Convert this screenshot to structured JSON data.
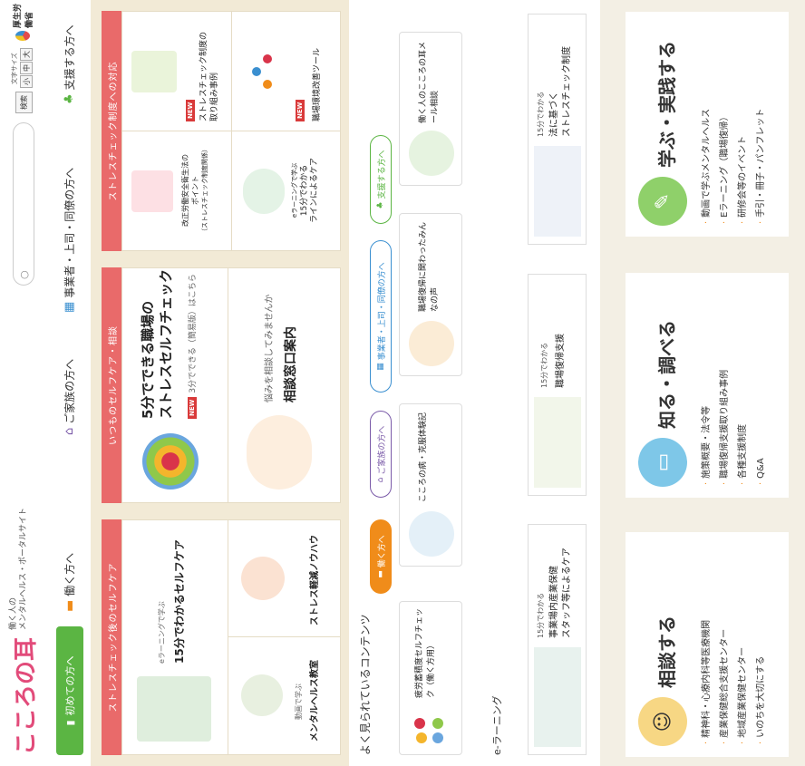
{
  "header": {
    "logo": "こころの耳",
    "subtitle_line1": "働く人の",
    "subtitle_line2": "メンタルヘルス・ポータルサイト",
    "first_time_button": "初めての方へ",
    "nav": [
      "働く方へ",
      "ご家族の方へ",
      "事業者・上司・同僚の方へ",
      "支援する方へ"
    ],
    "search_button": "検索",
    "font_size_label": "文字サイズ",
    "font_sizes": [
      "小",
      "中",
      "大"
    ],
    "ministry": "厚生労働省"
  },
  "sections": {
    "selfcare": {
      "bar": "ストレスチェック後のセルフケア",
      "item1_sub": "eラーニングで学ぶ",
      "item1_title": "15分でわかるセルフケア",
      "item2_sub": "動画で学ぶ",
      "item2_title": "メンタルヘルス教室",
      "item3_title": "ストレス軽減ノウハウ"
    },
    "everyday": {
      "bar": "いつものセルフケア・相談",
      "check_title_1": "5分でできる職場の",
      "check_title_2": "ストレスセルフチェック",
      "new_label": "NEW",
      "check_sub": "3分でできる（簡易版）はこちら",
      "consult_sub": "悩みを相談してみませんか",
      "consult_title": "相談窓口案内"
    },
    "stresscheck": {
      "bar": "ストレスチェック制度への対応",
      "new_label": "NEW",
      "item1_title_1": "改正労働安全衛生法の",
      "item1_title_2": "ポイント",
      "item1_title_3": "（ストレスチェック制度関係）",
      "item2_title_1": "ストレスチェック制度の",
      "item2_title_2": "取り組み事例",
      "item3_title_1": "eラーニングで学ぶ",
      "item3_title_2": "15分でわかる",
      "item3_title_3": "ラインによるケア",
      "item4_title": "職場環境改善ツール"
    }
  },
  "popular": {
    "heading": "よく見られているコンテンツ",
    "pills": [
      "働く方へ",
      "ご家族の方へ",
      "事業者・上司・同僚の方へ",
      "支援する方へ"
    ],
    "cards": [
      "疲労蓄積度セルフチェック（働く方用）",
      "こころの病・克服体験記",
      "職場復帰に関わったみんなの声",
      "働く人のこころの耳メール相談"
    ]
  },
  "elearning": {
    "heading": "e-ラーニング",
    "cards": [
      {
        "top": "15分でわかる",
        "title1": "事業場内産業保健",
        "title2": "スタッフ等によるケア"
      },
      {
        "top": "15分でわかる",
        "title1": "職場復帰支援",
        "title2": ""
      },
      {
        "top": "15分でわかる",
        "title1": "法に基づく",
        "title2": "ストレスチェック制度"
      }
    ]
  },
  "bottom": {
    "consult": {
      "title": "相談する",
      "items": [
        "精神科・心療内科等医療機関",
        "産業保健総合支援センター",
        "地域産業保健センター",
        "いのちを大切にする"
      ]
    },
    "learn": {
      "title": "知る・調べる",
      "items": [
        "施策概要・法令等",
        "職場復帰支援取り組み事例",
        "各種支援制度",
        "Q&A"
      ]
    },
    "practice": {
      "title": "学ぶ・実践する",
      "items": [
        "動画で学ぶメンタルヘルス",
        "Eラーニング（職場復帰）",
        "研修会等のイベント",
        "手引・冊子・パンフレット"
      ]
    }
  },
  "colors": {
    "logo": "#e24b7a",
    "green": "#5bb543",
    "red_bar": "#e96a6a",
    "beige": "#f2ead6",
    "orange": "#f08c1a",
    "purple": "#7a5aa8",
    "blue": "#3a8fd0"
  }
}
